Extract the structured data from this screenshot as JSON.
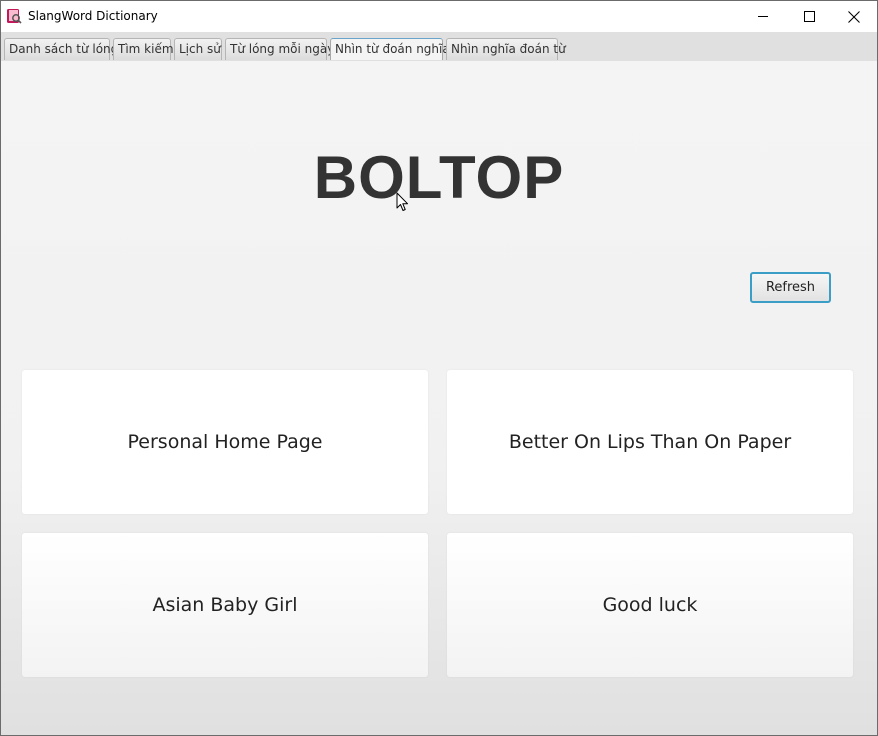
{
  "window": {
    "title": "SlangWord Dictionary",
    "icon": "dictionary-app-icon",
    "controls": [
      "minimize-icon",
      "maximize-icon",
      "close-icon"
    ]
  },
  "tabs": [
    {
      "label": "Danh sách từ lóng",
      "active": false
    },
    {
      "label": "Tìm kiếm",
      "active": false
    },
    {
      "label": "Lịch sử",
      "active": false
    },
    {
      "label": "Từ lóng mỗi ngày",
      "active": false
    },
    {
      "label": "Nhìn từ đoán nghĩa",
      "active": true
    },
    {
      "label": "Nhìn nghĩa đoán từ",
      "active": false
    }
  ],
  "quiz": {
    "word": "BOLTOP",
    "refresh_label": "Refresh",
    "options": [
      "Personal Home Page",
      "Better On Lips Than On Paper",
      "Asian Baby Girl",
      "Good luck"
    ]
  },
  "colors": {
    "accent_focus": "#3a9ec7",
    "word_text": "#333333",
    "background": "#f4f4f4"
  }
}
